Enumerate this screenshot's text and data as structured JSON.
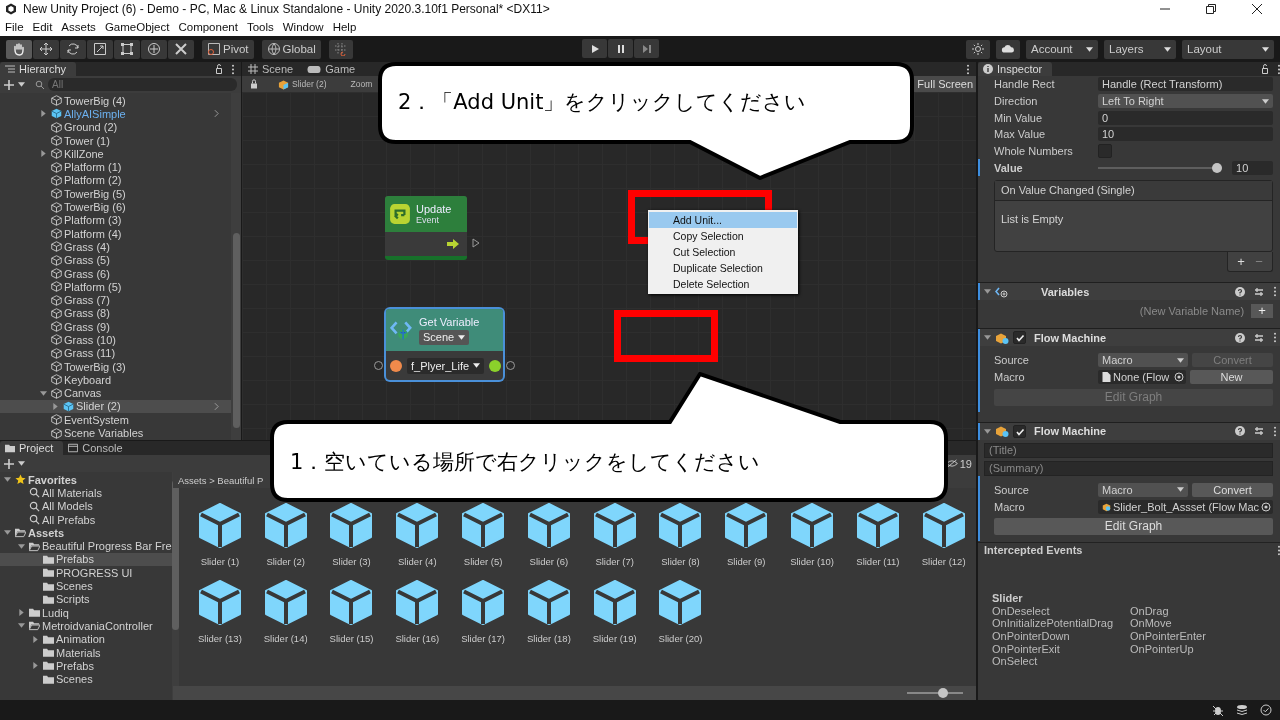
{
  "window": {
    "title": "New Unity Project (6) - Demo - PC, Mac & Linux Standalone - Unity 2020.3.10f1 Personal* <DX11>"
  },
  "menu": [
    "File",
    "Edit",
    "Assets",
    "GameObject",
    "Component",
    "Tools",
    "Window",
    "Help"
  ],
  "toolbar": {
    "tools": [
      {
        "kind": "hand",
        "selected": true
      },
      {
        "kind": "move",
        "selected": false
      },
      {
        "kind": "rotate",
        "selected": false
      },
      {
        "kind": "scale",
        "selected": false
      },
      {
        "kind": "rect",
        "selected": false
      },
      {
        "kind": "transform",
        "selected": false
      },
      {
        "kind": "custom",
        "selected": false
      }
    ],
    "pivot": "Pivot",
    "global": "Global",
    "account": "Account",
    "layers": "Layers",
    "layout": "Layout"
  },
  "hierarchy": {
    "tab": "Hierarchy",
    "search": {
      "placeholder": "All"
    },
    "items": [
      {
        "name": "TowerBig (4)",
        "kind": "object",
        "selected": false
      },
      {
        "name": "AllyAISimple",
        "kind": "prefab",
        "expanded": false,
        "selected": false
      },
      {
        "name": "Ground (2)",
        "kind": "object",
        "selected": false
      },
      {
        "name": "Tower (1)",
        "kind": "object",
        "selected": false
      },
      {
        "name": "KillZone",
        "kind": "object",
        "expanded": false,
        "selected": false
      },
      {
        "name": "Platform (1)",
        "kind": "object",
        "selected": false
      },
      {
        "name": "Platform (2)",
        "kind": "object",
        "selected": false
      },
      {
        "name": "TowerBig (5)",
        "kind": "object",
        "selected": false
      },
      {
        "name": "TowerBig (6)",
        "kind": "object",
        "selected": false
      },
      {
        "name": "Platform (3)",
        "kind": "object",
        "selected": false
      },
      {
        "name": "Platform (4)",
        "kind": "object",
        "selected": false
      },
      {
        "name": "Grass (4)",
        "kind": "object",
        "selected": false
      },
      {
        "name": "Grass (5)",
        "kind": "object",
        "selected": false
      },
      {
        "name": "Grass (6)",
        "kind": "object",
        "selected": false
      },
      {
        "name": "Platform (5)",
        "kind": "object",
        "selected": false
      },
      {
        "name": "Grass (7)",
        "kind": "object",
        "selected": false
      },
      {
        "name": "Grass (8)",
        "kind": "object",
        "selected": false
      },
      {
        "name": "Grass (9)",
        "kind": "object",
        "selected": false
      },
      {
        "name": "Grass (10)",
        "kind": "object",
        "selected": false
      },
      {
        "name": "Grass (11)",
        "kind": "object",
        "selected": false
      },
      {
        "name": "TowerBig (3)",
        "kind": "object",
        "selected": false
      },
      {
        "name": "Keyboard",
        "kind": "object",
        "selected": false
      },
      {
        "name": "Canvas",
        "kind": "object",
        "expanded": true,
        "selected": false,
        "children": [
          {
            "name": "Slider (2)",
            "kind": "prefab",
            "expanded": false,
            "selected": true
          }
        ]
      },
      {
        "name": "EventSystem",
        "kind": "object",
        "selected": false
      },
      {
        "name": "Scene Variables",
        "kind": "object",
        "selected": false
      }
    ]
  },
  "scene": {
    "tabs": [
      {
        "label": "Scene",
        "kind": "scene",
        "selected": false
      },
      {
        "label": "Game",
        "kind": "game",
        "selected": false
      }
    ],
    "object": "Slider (2)",
    "zoom": "Zoom",
    "full_screen": "Full Screen"
  },
  "graph": {
    "nodes": [
      {
        "kind": "event",
        "title": "Update",
        "subtitle": "Event",
        "selected": false
      },
      {
        "kind": "variable",
        "title": "Get Variable",
        "scope": "Scene",
        "variable": "f_Plyer_Life",
        "selected": true
      }
    ],
    "context_menu": [
      {
        "label": "Add Unit...",
        "selected": true
      },
      {
        "label": "Copy Selection",
        "selected": false
      },
      {
        "label": "Cut Selection",
        "selected": false
      },
      {
        "label": "Duplicate Selection",
        "selected": false
      },
      {
        "label": "Delete Selection",
        "selected": false
      }
    ],
    "callouts": [
      {
        "text": "2．「Add Unit」をクリックしてください"
      },
      {
        "text": "1．空いている場所で右クリックをしてください"
      }
    ]
  },
  "inspector": {
    "tab": "Inspector",
    "handle_rect": {
      "label": "Handle Rect",
      "value": "Handle (Rect Transform)"
    },
    "properties": [
      {
        "kind": "dropdown",
        "label": "Direction",
        "value": "Left To Right"
      },
      {
        "kind": "text",
        "label": "Min Value",
        "value": "0"
      },
      {
        "kind": "text",
        "label": "Max Value",
        "value": "10"
      },
      {
        "kind": "checkbox",
        "label": "Whole Numbers",
        "checked": false
      },
      {
        "kind": "slider",
        "label": "Value",
        "level": 1,
        "value": "10"
      }
    ],
    "event": {
      "title": "On Value Changed (Single)",
      "empty": "List is Empty",
      "add": "+",
      "remove": "−"
    },
    "variables": {
      "title": "Variables",
      "placeholder": "(New Variable Name)",
      "add": "+"
    },
    "machines": [
      {
        "title": "Flow Machine",
        "enabled": true,
        "source_label": "Source",
        "source": "Macro",
        "convert": {
          "label": "Convert",
          "disabled": true
        },
        "macro_label": "Macro",
        "macro": "None (Flow",
        "new": "New",
        "edit": {
          "label": "Edit Graph",
          "disabled": true
        }
      },
      {
        "title": "Flow Machine",
        "enabled": true,
        "title_placeholder": "(Title)",
        "summary_placeholder": "(Summary)",
        "source_label": "Source",
        "source": "Macro",
        "convert": {
          "label": "Convert",
          "disabled": false
        },
        "macro_label": "Macro",
        "macro": "Slider_Bolt_Assset (Flow Mac",
        "edit": {
          "label": "Edit Graph",
          "disabled": false
        }
      }
    ],
    "intercepted": {
      "title": "Intercepted Events",
      "group": "Slider",
      "events_left": [
        "OnDeselect",
        "OnInitializePotentialDrag",
        "OnPointerDown",
        "OnPointerExit",
        "OnSelect"
      ],
      "events_right": [
        "OnDrag",
        "OnMove",
        "OnPointerEnter",
        "OnPointerUp"
      ]
    }
  },
  "project": {
    "tabs": [
      {
        "label": "Project",
        "kind": "project",
        "selected": true
      },
      {
        "label": "Console",
        "kind": "console",
        "selected": false
      }
    ],
    "hidden_count": "19",
    "breadcrumb": "Assets > Beautiful P",
    "tree": [
      {
        "label": "Favorites",
        "kind": "favorites",
        "expanded": true,
        "selected": false,
        "children": [
          {
            "label": "All Materials",
            "kind": "search",
            "selected": false
          },
          {
            "label": "All Models",
            "kind": "search",
            "selected": false
          },
          {
            "label": "All Prefabs",
            "kind": "search",
            "selected": false
          }
        ]
      },
      {
        "label": "Assets",
        "kind": "folder",
        "expanded": true,
        "selected": false,
        "children": [
          {
            "label": "Beautiful Progress Bar Fre",
            "kind": "folder",
            "expanded": true,
            "selected": false,
            "children": [
              {
                "label": "Prefabs",
                "kind": "folder",
                "selected": true
              },
              {
                "label": "PROGRESS UI",
                "kind": "folder",
                "selected": false
              },
              {
                "label": "Scenes",
                "kind": "folder",
                "selected": false
              },
              {
                "label": "Scripts",
                "kind": "folder",
                "selected": false
              }
            ]
          },
          {
            "label": "Ludiq",
            "kind": "folder",
            "expanded": false,
            "selected": false
          },
          {
            "label": "MetroidvaniaController",
            "kind": "folder",
            "expanded": true,
            "selected": false,
            "children": [
              {
                "label": "Animation",
                "kind": "folder",
                "expanded": false,
                "selected": false
              },
              {
                "label": "Materials",
                "kind": "folder",
                "selected": false
              },
              {
                "label": "Prefabs",
                "kind": "folder",
                "expanded": false,
                "selected": false
              },
              {
                "label": "Scenes",
                "kind": "folder",
                "selected": false
              }
            ]
          }
        ]
      }
    ],
    "assets": [
      "Slider (1)",
      "Slider (2)",
      "Slider (3)",
      "Slider (4)",
      "Slider (5)",
      "Slider (6)",
      "Slider (7)",
      "Slider (8)",
      "Slider (9)",
      "Slider (10)",
      "Slider (11)",
      "Slider (12)",
      "Slider (13)",
      "Slider (14)",
      "Slider (15)",
      "Slider (16)",
      "Slider (17)",
      "Slider (18)",
      "Slider (19)",
      "Slider (20)"
    ],
    "zoom": {
      "level": 0.65
    }
  }
}
